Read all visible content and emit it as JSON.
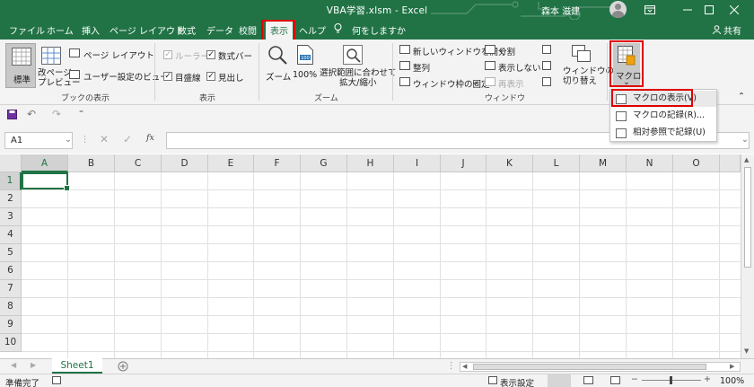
{
  "window": {
    "title": "VBA学習.xlsm  -  Excel",
    "user_name": "森本 滋建",
    "restore_icon": "ribbon-display-icon",
    "min_icon": "minimize-icon",
    "max_icon": "maximize-icon",
    "close_icon": "close-icon"
  },
  "ribbon_tabs": [
    "ファイル",
    "ホーム",
    "挿入",
    "ページ レイアウト",
    "数式",
    "データ",
    "校閲",
    "表示",
    "ヘルプ"
  ],
  "active_tab": "表示",
  "tell_me": "何をしますか",
  "share": "共有",
  "groups": {
    "book_view": {
      "label": "ブックの表示",
      "normal": "標準",
      "page_break": "改ページ\nプレビュー",
      "page_layout": "ページ レイアウト",
      "custom_views": "ユーザー設定のビュー"
    },
    "show": {
      "label": "表示",
      "ruler": "ルーラー",
      "formula_bar": "数式バー",
      "gridlines": "目盛線",
      "headings": "見出し"
    },
    "zoom": {
      "label": "ズーム",
      "zoom": "ズーム",
      "zoom100": "100%",
      "zoom_selection": "選択範囲に合わせて\n拡大/縮小"
    },
    "window": {
      "label": "ウィンドウ",
      "new_window": "新しいウィンドウを開く",
      "arrange": "整列",
      "freeze": "ウィンドウ枠の固定",
      "split": "分割",
      "hide": "表示しない",
      "unhide": "再表示",
      "switch": "ウィンドウの\n切り替え"
    },
    "macro": {
      "label": "マクロ"
    }
  },
  "macro_menu": [
    {
      "label": "マクロの表示(V)",
      "highlighted": true
    },
    {
      "label": "マクロの記録(R)...",
      "highlighted": false
    },
    {
      "label": "相対参照で記録(U)",
      "highlighted": false
    }
  ],
  "namebox": "A1",
  "fx": "fx",
  "columns": [
    "A",
    "B",
    "C",
    "D",
    "E",
    "F",
    "G",
    "H",
    "I",
    "J",
    "K",
    "L",
    "M",
    "N",
    "O"
  ],
  "rows": [
    "1",
    "2",
    "3",
    "4",
    "5",
    "6",
    "7",
    "8",
    "9",
    "10"
  ],
  "selected_cell": "A1",
  "sheet_tabs": [
    "Sheet1"
  ],
  "status": {
    "ready": "準備完了",
    "display_settings": "表示設定",
    "zoom": "100%"
  },
  "colors": {
    "excel_green": "#217346",
    "highlight_red": "#e00000"
  }
}
